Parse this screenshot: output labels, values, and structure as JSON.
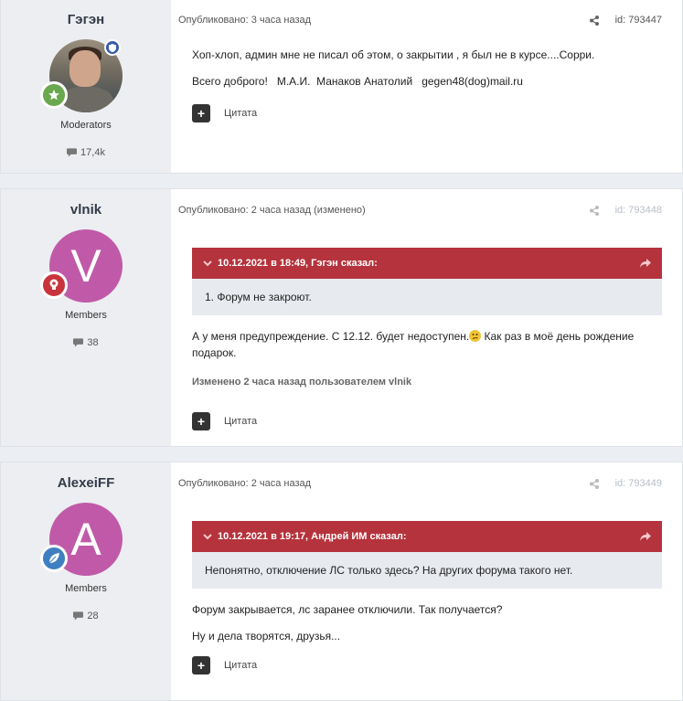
{
  "posts": [
    {
      "author": "Гэгэн",
      "group": "Moderators",
      "post_count": "17,4k",
      "avatar_letter": "",
      "published": "Опубликовано: 3 часа назад",
      "id": "id: 793447",
      "lines": [
        "Хоп-хлоп, админ мне не писал об этом, о закрытии , я был не в курсе....Сорри.",
        "Всего доброго!   М.А.И.  Манаков Анатолий   gegen48(dog)mail.ru"
      ],
      "quote_label": "Цитата"
    },
    {
      "author": "vlnik",
      "group": "Members",
      "post_count": "38",
      "avatar_letter": "V",
      "published": "Опубликовано: 2 часа назад (изменено)",
      "id": "id: 793448",
      "quote_header": "10.12.2021 в 18:49, Гэгэн сказал:",
      "quote_text": "1. Форум не закроют.",
      "text_before_emoji": "А у меня предупреждение.  С 12.12. будет недоступен.",
      "text_after_emoji": "  Как раз в моё день рождение подарок.",
      "edited": "Изменено 2 часа назад пользователем vlnik",
      "quote_label": "Цитата"
    },
    {
      "author": "AlexeiFF",
      "group": "Members",
      "post_count": "28",
      "avatar_letter": "A",
      "published": "Опубликовано: 2 часа назад",
      "id": "id: 793449",
      "quote_header": "10.12.2021 в 19:17, Андрей ИМ сказал:",
      "quote_text": "Непонятно, отключение ЛС только здесь? На других форума такого нет.",
      "lines": [
        "Форум закрывается, лс заранее отключили. Так получается?",
        "Ну и дела творятся, друзья..."
      ],
      "quote_label": "Цитата"
    }
  ],
  "colors": {
    "quote_header": "#b5333c",
    "avatar_v": "#c05aa8",
    "avatar_a": "#c05aa8",
    "badge_star": "#6aa84f",
    "badge_red": "#c9343c",
    "badge_blue": "#3f7fc1"
  },
  "icons": [
    "share-icon",
    "comment-icon",
    "chevron-down-icon",
    "reply-arrow-icon",
    "plus-icon",
    "star-badge-icon",
    "bulb-badge-icon",
    "leaf-badge-icon",
    "moderator-shield-icon",
    "confused-emoji-icon"
  ]
}
